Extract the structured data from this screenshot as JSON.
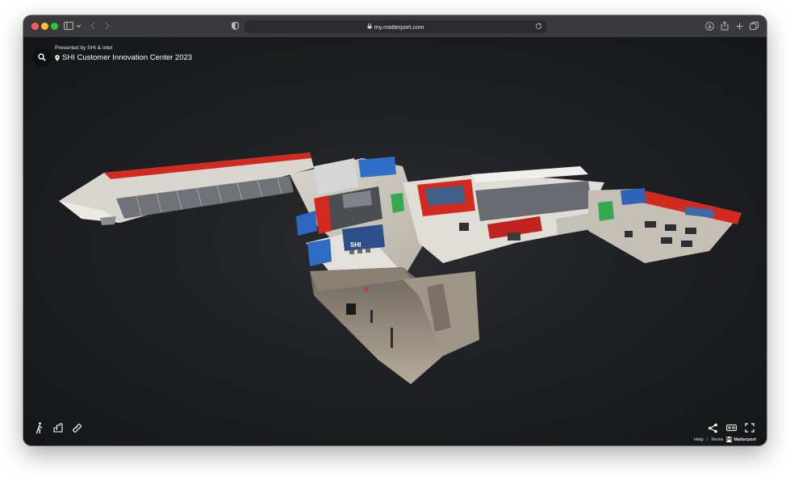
{
  "browser": {
    "url": "my.matterport.com",
    "colors": {
      "close": "#ff5f57",
      "minimize": "#febc2e",
      "zoom": "#28c840"
    },
    "icons": [
      "sidebar-icon",
      "chevron-down-icon",
      "back-icon",
      "forward-icon",
      "shield-icon",
      "lock-icon",
      "reload-icon",
      "download-icon",
      "share-icon",
      "new-tab-icon",
      "tabs-overview-icon"
    ]
  },
  "header": {
    "presented_by": "Presented by SHI & Intel",
    "title": "SHI Customer Innovation Center 2023"
  },
  "tools": {
    "left": [
      "walk-icon",
      "floorplan-icon",
      "measure-icon"
    ],
    "right": [
      "share-icon",
      "vr-icon",
      "fullscreen-icon"
    ]
  },
  "footer": {
    "help": "Help",
    "separator": "|",
    "terms": "Terms",
    "brand": "Matterport"
  }
}
